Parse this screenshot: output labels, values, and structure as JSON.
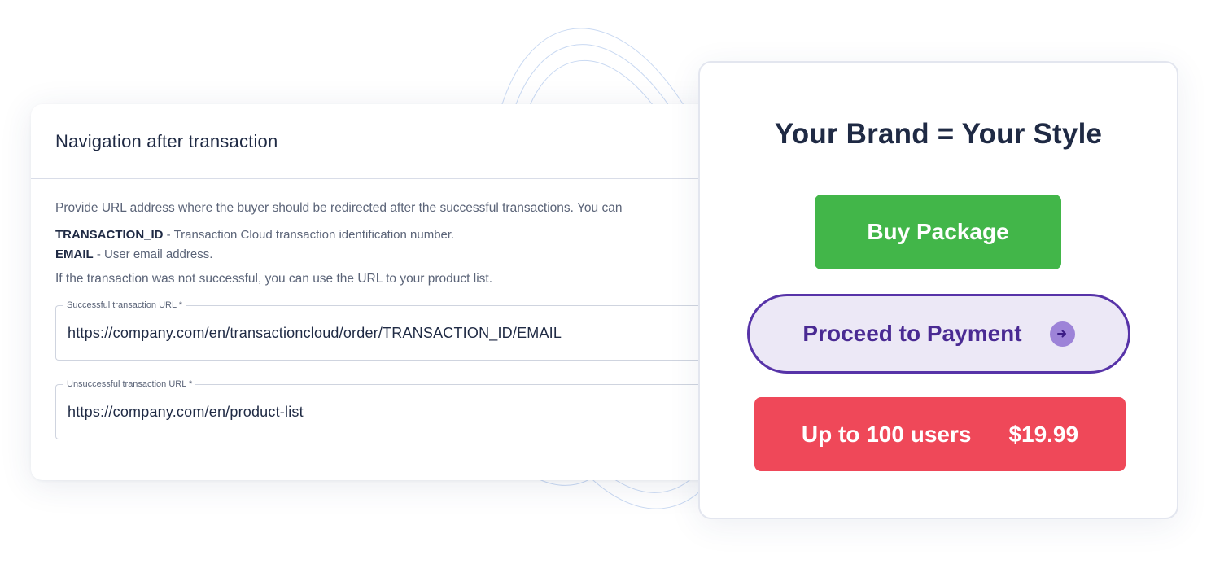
{
  "navigation_card": {
    "title": "Navigation after transaction",
    "intro": "Provide URL address where the buyer should be redirected after the successful transactions. You can",
    "variables": [
      {
        "key": "TRANSACTION_ID",
        "description": " - Transaction Cloud transaction identification number."
      },
      {
        "key": "EMAIL",
        "description": " - User email address."
      }
    ],
    "failure_note": "If the transaction was not successful, you can use the URL to your product list.",
    "fields": {
      "success": {
        "label": "Successful transaction URL *",
        "value": "https://company.com/en/transactioncloud/order/TRANSACTION_ID/EMAIL"
      },
      "failure": {
        "label": "Unsuccessful transaction URL *",
        "value": "https://company.com/en/product-list"
      }
    }
  },
  "brand_card": {
    "title": "Your Brand = Your Style",
    "buy_button": {
      "label": "Buy Package",
      "color": "#42b649"
    },
    "proceed_button": {
      "label": "Proceed to Payment",
      "icon": "arrow-right-icon",
      "color": "#5733a8"
    },
    "price_button": {
      "plan": "Up to 100 users",
      "price": "$19.99",
      "color": "#ef4859"
    }
  }
}
